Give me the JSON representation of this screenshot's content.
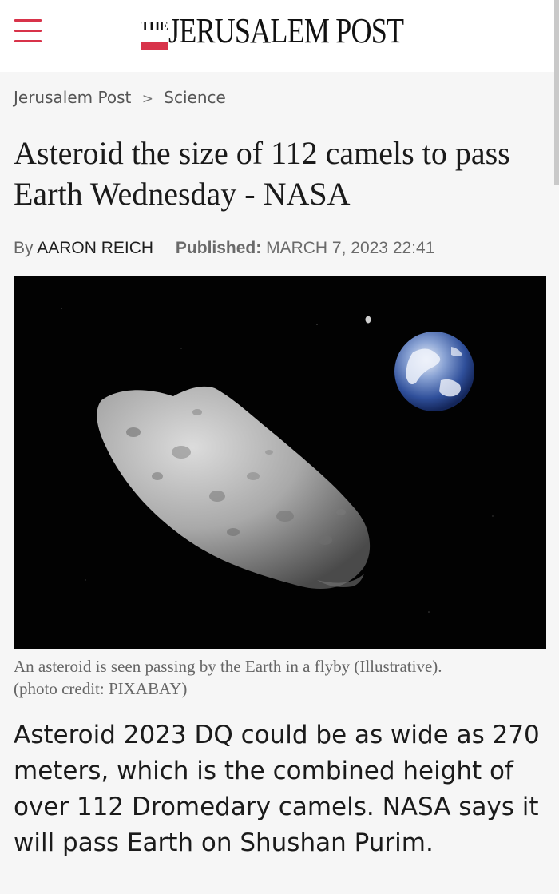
{
  "header": {
    "logo_the": "THE",
    "logo_name": "JERUSALEM POST",
    "brand_color": "#d8334a"
  },
  "breadcrumb": {
    "home": "Jerusalem Post",
    "separator": ">",
    "section": "Science"
  },
  "article": {
    "headline": "Asteroid the size of 112 camels to pass Earth Wednesday - NASA",
    "byline_prefix": "By",
    "author": "AARON REICH",
    "published_label": "Published:",
    "published_date": "MARCH 7, 2023 22:41",
    "image": {
      "subject": "asteroid-and-earth",
      "caption": "An asteroid is seen passing by the Earth in a flyby (Illustrative).",
      "credit": "(photo credit: PIXABAY)"
    },
    "lede": "Asteroid 2023 DQ could be as wide as 270 meters, which is the combined height of over 112 Dromedary camels. NASA says it will pass Earth on Shushan Purim."
  }
}
